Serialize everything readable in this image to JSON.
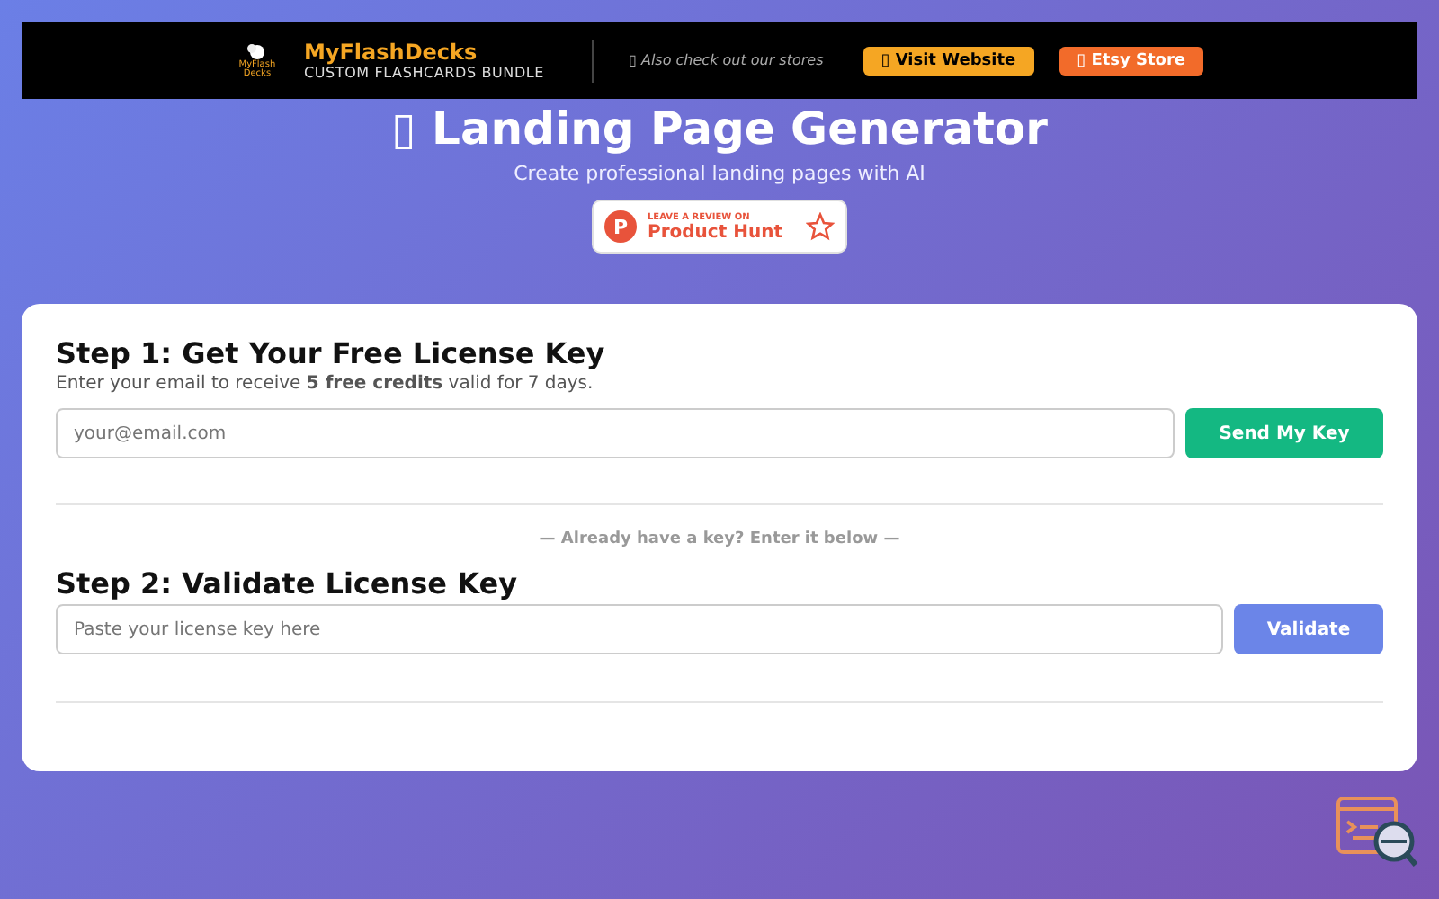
{
  "banner": {
    "logo_text": "MyFlash Decks",
    "brand": "MyFlashDecks",
    "tagline": "CUSTOM FLASHCARDS BUNDLE",
    "note": "▯ Also check out our stores",
    "buttons": [
      {
        "label": "▯ Visit Website",
        "color": "#f5a623"
      },
      {
        "label": "▯ Etsy Store",
        "color": "#f26b2a"
      }
    ]
  },
  "header": {
    "title": "▯ Landing Page Generator",
    "subtitle": "Create professional landing pages with AI",
    "badge": {
      "letter": "P",
      "small": "LEAVE A REVIEW ON",
      "big": "Product Hunt"
    }
  },
  "card": {
    "step1": {
      "title": "Step 1: Get Your Free License Key",
      "text": "Enter your email to receive **5 free credits** valid for 7 days.",
      "placeholder": "your@email.com",
      "button": "Send My Key"
    },
    "divider_text": "— Already have a key? Enter it below —",
    "step2": {
      "title": "Step 2: Validate License Key",
      "placeholder": "Paste your license key here",
      "button": "Validate"
    }
  }
}
